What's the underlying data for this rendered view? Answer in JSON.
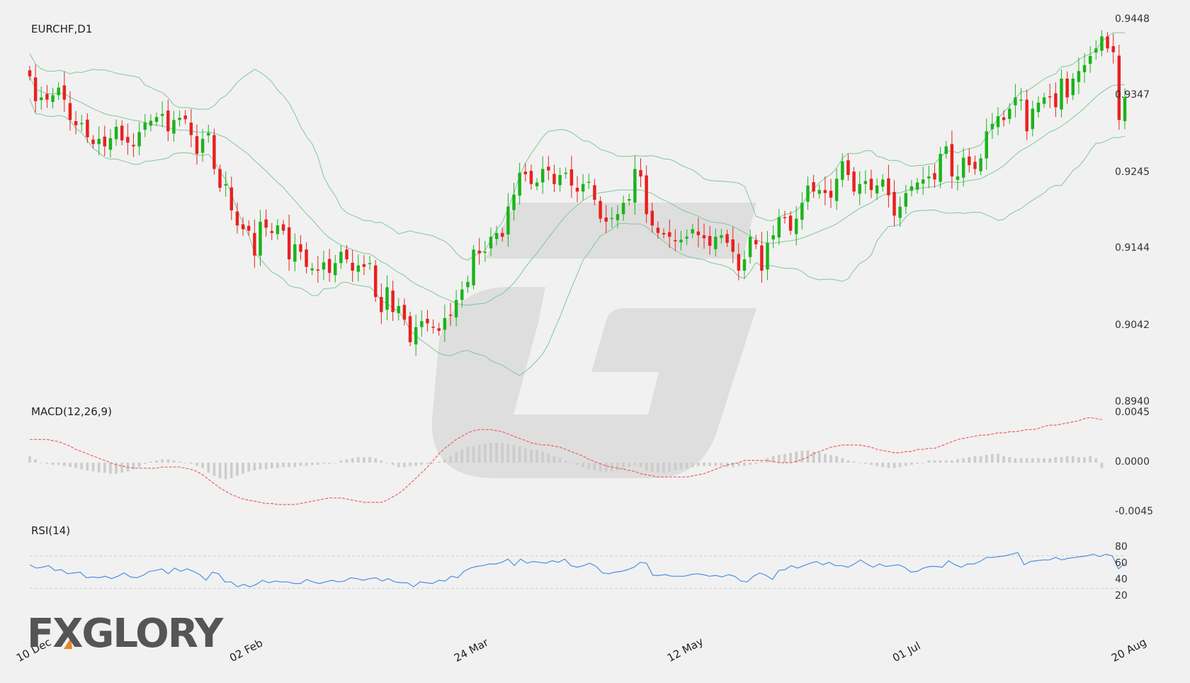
{
  "chart_data": [
    {
      "type": "candlestick",
      "title": "EURCHF,D1",
      "y_ticks": [
        "0.9448",
        "0.9347",
        "0.9245",
        "0.9144",
        "0.9042",
        "0.8940"
      ],
      "ylim": [
        0.894,
        0.9448
      ],
      "x_tick_labels": [
        "10 Dec",
        "02 Feb",
        "24 Mar",
        "12 May",
        "01 Jul",
        "20 Aug"
      ],
      "x_tick_index": [
        0,
        37,
        76,
        113,
        152,
        190
      ],
      "colors": {
        "up": "#1bb31b",
        "down": "#e82020",
        "bands": "#7fc79a"
      },
      "bollinger_bands": true,
      "close": [
        0.9373,
        0.934,
        0.9345,
        0.9342,
        0.9348,
        0.9358,
        0.9342,
        0.9315,
        0.9308,
        0.9311,
        0.9292,
        0.9283,
        0.929,
        0.928,
        0.9291,
        0.9306,
        0.9288,
        0.9285,
        0.928,
        0.9299,
        0.9312,
        0.9314,
        0.9319,
        0.9323,
        0.93,
        0.9315,
        0.9318,
        0.9316,
        0.9295,
        0.927,
        0.929,
        0.9298,
        0.925,
        0.9225,
        0.923,
        0.9195,
        0.9175,
        0.917,
        0.9168,
        0.9135,
        0.918,
        0.9172,
        0.9165,
        0.9175,
        0.9168,
        0.913,
        0.915,
        0.914,
        0.912,
        0.9118,
        0.9115,
        0.9126,
        0.9112,
        0.9125,
        0.914,
        0.913,
        0.9115,
        0.9122,
        0.912,
        0.9125,
        0.908,
        0.906,
        0.9093,
        0.906,
        0.9068,
        0.905,
        0.902,
        0.904,
        0.9048,
        0.9045,
        0.904,
        0.9035,
        0.9052,
        0.9056,
        0.9076,
        0.909,
        0.91,
        0.9143,
        0.9138,
        0.914,
        0.916,
        0.9165,
        0.916,
        0.92,
        0.9216,
        0.9245,
        0.9243,
        0.923,
        0.9232,
        0.925,
        0.9248,
        0.923,
        0.9242,
        0.9245,
        0.9228,
        0.922,
        0.923,
        0.9233,
        0.9209,
        0.9184,
        0.918,
        0.9185,
        0.919,
        0.9205,
        0.921,
        0.925,
        0.924,
        0.919,
        0.9175,
        0.9165,
        0.9163,
        0.916,
        0.9154,
        0.9156,
        0.916,
        0.917,
        0.9162,
        0.9158,
        0.9148,
        0.916,
        0.9162,
        0.9152,
        0.914,
        0.9115,
        0.913,
        0.916,
        0.915,
        0.9115,
        0.9152,
        0.9162,
        0.9186,
        0.9185,
        0.9168,
        0.9184,
        0.9205,
        0.9228,
        0.922,
        0.9222,
        0.9218,
        0.9212,
        0.9237,
        0.926,
        0.9242,
        0.922,
        0.923,
        0.9234,
        0.9222,
        0.9228,
        0.9236,
        0.9215,
        0.9188,
        0.92,
        0.9218,
        0.9227,
        0.9232,
        0.9236,
        0.924,
        0.9236,
        0.927,
        0.928,
        0.924,
        0.924,
        0.9265,
        0.9255,
        0.925,
        0.9264,
        0.93,
        0.931,
        0.932,
        0.9315,
        0.933,
        0.9345,
        0.9342,
        0.93,
        0.933,
        0.9338,
        0.9345,
        0.9346,
        0.9332,
        0.937,
        0.9345,
        0.937,
        0.938,
        0.9388,
        0.94,
        0.941,
        0.9426,
        0.941,
        0.9405,
        0.9315,
        0.9345
      ]
    },
    {
      "type": "histogram+line",
      "title": "MACD(12,26,9)",
      "y_ticks": [
        "0.0045",
        "0.0000",
        "-0.0045"
      ],
      "ylim": [
        -0.0045,
        0.0045
      ],
      "colors": {
        "histogram": "#cccccc",
        "signal": "#f06060"
      },
      "histogram": [
        0.0006,
        0.0003,
        0.0,
        -0.0001,
        -0.0002,
        -0.0002,
        -0.0003,
        -0.0004,
        -0.0005,
        -0.0006,
        -0.0007,
        -0.0008,
        -0.0009,
        -0.0009,
        -0.001,
        -0.001,
        -0.0009,
        -0.0008,
        -0.0006,
        -0.0004,
        -0.0001,
        0.0001,
        0.0002,
        0.0003,
        0.0003,
        0.0002,
        0.0001,
        0.0,
        -0.0001,
        -0.0003,
        -0.0005,
        -0.0009,
        -0.0012,
        -0.0014,
        -0.0015,
        -0.0014,
        -0.0012,
        -0.001,
        -0.0008,
        -0.0007,
        -0.0006,
        -0.0006,
        -0.0005,
        -0.0005,
        -0.0004,
        -0.0004,
        -0.0004,
        -0.0003,
        -0.0003,
        -0.0002,
        -0.0002,
        -0.0001,
        -0.0001,
        0.0,
        0.0002,
        0.0003,
        0.0004,
        0.0005,
        0.0005,
        0.0005,
        0.0004,
        0.0002,
        0.0,
        -0.0002,
        -0.0004,
        -0.0004,
        -0.0003,
        -0.0003,
        -0.0002,
        -0.0001,
        0.0,
        0.0001,
        0.0003,
        0.0006,
        0.0009,
        0.0012,
        0.0014,
        0.0015,
        0.0016,
        0.0017,
        0.0018,
        0.0018,
        0.0018,
        0.0017,
        0.0016,
        0.0015,
        0.0013,
        0.0012,
        0.0011,
        0.001,
        0.0008,
        0.0006,
        0.0004,
        0.0002,
        0.0,
        -0.0002,
        -0.0004,
        -0.0006,
        -0.0007,
        -0.0008,
        -0.0008,
        -0.0008,
        -0.0007,
        -0.0006,
        -0.0004,
        -0.0002,
        -0.0004,
        -0.0007,
        -0.0008,
        -0.0009,
        -0.0009,
        -0.0008,
        -0.0007,
        -0.0006,
        -0.0005,
        -0.0004,
        -0.0003,
        -0.0003,
        -0.0003,
        -0.0003,
        -0.0003,
        -0.0004,
        -0.0004,
        -0.0003,
        -0.0003,
        -0.0002,
        -0.0001,
        0.0001,
        0.0004,
        0.0006,
        0.0007,
        0.0008,
        0.0009,
        0.001,
        0.0011,
        0.0011,
        0.001,
        0.0009,
        0.0008,
        0.0007,
        0.0006,
        0.0004,
        0.0002,
        0.0001,
        0.0,
        -0.0001,
        -0.0002,
        -0.0003,
        -0.0004,
        -0.0005,
        -0.0005,
        -0.0004,
        -0.0003,
        -0.0002,
        -0.0001,
        0.0,
        0.0002,
        0.0002,
        0.0002,
        0.0002,
        0.0002,
        0.0003,
        0.0004,
        0.0005,
        0.0006,
        0.0006,
        0.0007,
        0.0008,
        0.0008,
        0.0006,
        0.0005,
        0.0004,
        0.0004,
        0.0004,
        0.0004,
        0.0004,
        0.0004,
        0.0004,
        0.0005,
        0.0005,
        0.0006,
        0.0006,
        0.0005,
        0.0005,
        0.0006,
        0.0004,
        -0.0005
      ],
      "signal": [
        0.0021,
        0.0021,
        0.0021,
        0.0021,
        0.002,
        0.0019,
        0.0017,
        0.0015,
        0.0012,
        0.001,
        0.0008,
        0.0006,
        0.0004,
        0.0002,
        0.0,
        -0.0002,
        -0.0003,
        -0.0004,
        -0.0005,
        -0.0005,
        -0.0005,
        -0.0005,
        -0.0005,
        -0.0004,
        -0.0004,
        -0.0004,
        -0.0004,
        -0.0005,
        -0.0006,
        -0.0008,
        -0.0011,
        -0.0015,
        -0.0019,
        -0.0023,
        -0.0026,
        -0.0029,
        -0.0031,
        -0.0033,
        -0.0034,
        -0.0035,
        -0.0036,
        -0.0037,
        -0.0037,
        -0.0038,
        -0.0038,
        -0.0038,
        -0.0038,
        -0.0037,
        -0.0036,
        -0.0035,
        -0.0034,
        -0.0033,
        -0.0032,
        -0.0032,
        -0.0032,
        -0.0033,
        -0.0034,
        -0.0035,
        -0.0036,
        -0.0036,
        -0.0036,
        -0.0036,
        -0.0034,
        -0.0031,
        -0.0028,
        -0.0024,
        -0.0019,
        -0.0014,
        -0.0009,
        -0.0004,
        0.0002,
        0.0008,
        0.0013,
        0.0017,
        0.0021,
        0.0024,
        0.0027,
        0.0029,
        0.003,
        0.003,
        0.003,
        0.0029,
        0.0028,
        0.0026,
        0.0024,
        0.0022,
        0.002,
        0.0018,
        0.0017,
        0.0016,
        0.0016,
        0.0015,
        0.0014,
        0.0012,
        0.001,
        0.0008,
        0.0006,
        0.0003,
        0.0001,
        -0.0001,
        -0.0003,
        -0.0004,
        -0.0005,
        -0.0006,
        -0.0007,
        -0.0008,
        -0.001,
        -0.0011,
        -0.0012,
        -0.0013,
        -0.0013,
        -0.0013,
        -0.0013,
        -0.0013,
        -0.0013,
        -0.0012,
        -0.0011,
        -0.001,
        -0.0008,
        -0.0006,
        -0.0004,
        -0.0002,
        -0.0001,
        0.0,
        0.0002,
        0.0002,
        0.0002,
        0.0002,
        0.0002,
        0.0001,
        0.0,
        0.0,
        0.0,
        0.0001,
        0.0003,
        0.0005,
        0.0008,
        0.001,
        0.0012,
        0.0014,
        0.0015,
        0.0016,
        0.0016,
        0.0016,
        0.0016,
        0.0015,
        0.0014,
        0.0012,
        0.0011,
        0.001,
        0.0009,
        0.0009,
        0.001,
        0.001,
        0.0012,
        0.0012,
        0.0013,
        0.0013,
        0.0015,
        0.0017,
        0.0019,
        0.0021,
        0.0022,
        0.0023,
        0.0024,
        0.0025,
        0.0025,
        0.0026,
        0.0027,
        0.0027,
        0.0028,
        0.0028,
        0.0029,
        0.003,
        0.003,
        0.0031,
        0.0033,
        0.0034,
        0.0034,
        0.0035,
        0.0036,
        0.0037,
        0.0038,
        0.004,
        0.0041,
        0.004,
        0.0039
      ]
    },
    {
      "type": "line",
      "title": "RSI(14)",
      "y_ticks": [
        "80",
        "60",
        "40",
        "20"
      ],
      "ylim": [
        20,
        80
      ],
      "levels": [
        70,
        30
      ],
      "colors": {
        "line": "#4a90e2"
      },
      "values": [
        59,
        55,
        56,
        58,
        52,
        53,
        48,
        49,
        50,
        43,
        44,
        43,
        45,
        42,
        45,
        49,
        44,
        43,
        46,
        51,
        52,
        54,
        48,
        55,
        51,
        54,
        51,
        47,
        40,
        50,
        48,
        38,
        38,
        32,
        35,
        32,
        35,
        40,
        37,
        39,
        38,
        38,
        36,
        36,
        41,
        38,
        36,
        38,
        40,
        38,
        39,
        43,
        42,
        40,
        42,
        43,
        39,
        42,
        38,
        37,
        37,
        32,
        38,
        37,
        36,
        40,
        39,
        45,
        43,
        51,
        55,
        57,
        58,
        60,
        60,
        62,
        66,
        58,
        66,
        61,
        63,
        62,
        61,
        64,
        62,
        66,
        58,
        56,
        58,
        61,
        57,
        49,
        48,
        50,
        51,
        53,
        56,
        62,
        61,
        46,
        46,
        47,
        45,
        45,
        45,
        47,
        48,
        47,
        45,
        46,
        44,
        47,
        45,
        39,
        38,
        45,
        49,
        46,
        41,
        52,
        53,
        58,
        55,
        58,
        61,
        63,
        59,
        62,
        58,
        58,
        56,
        60,
        65,
        60,
        56,
        60,
        57,
        58,
        59,
        56,
        50,
        51,
        55,
        57,
        57,
        56,
        64,
        59,
        56,
        60,
        60,
        63,
        68,
        68,
        69,
        70,
        72,
        74,
        59,
        63,
        64,
        65,
        65,
        68,
        65,
        67,
        68,
        69,
        70,
        72,
        69,
        72,
        70,
        54,
        61
      ]
    }
  ],
  "logo": {
    "text": "FXGLORY",
    "accent": "#e8852c",
    "color": "#555555"
  }
}
